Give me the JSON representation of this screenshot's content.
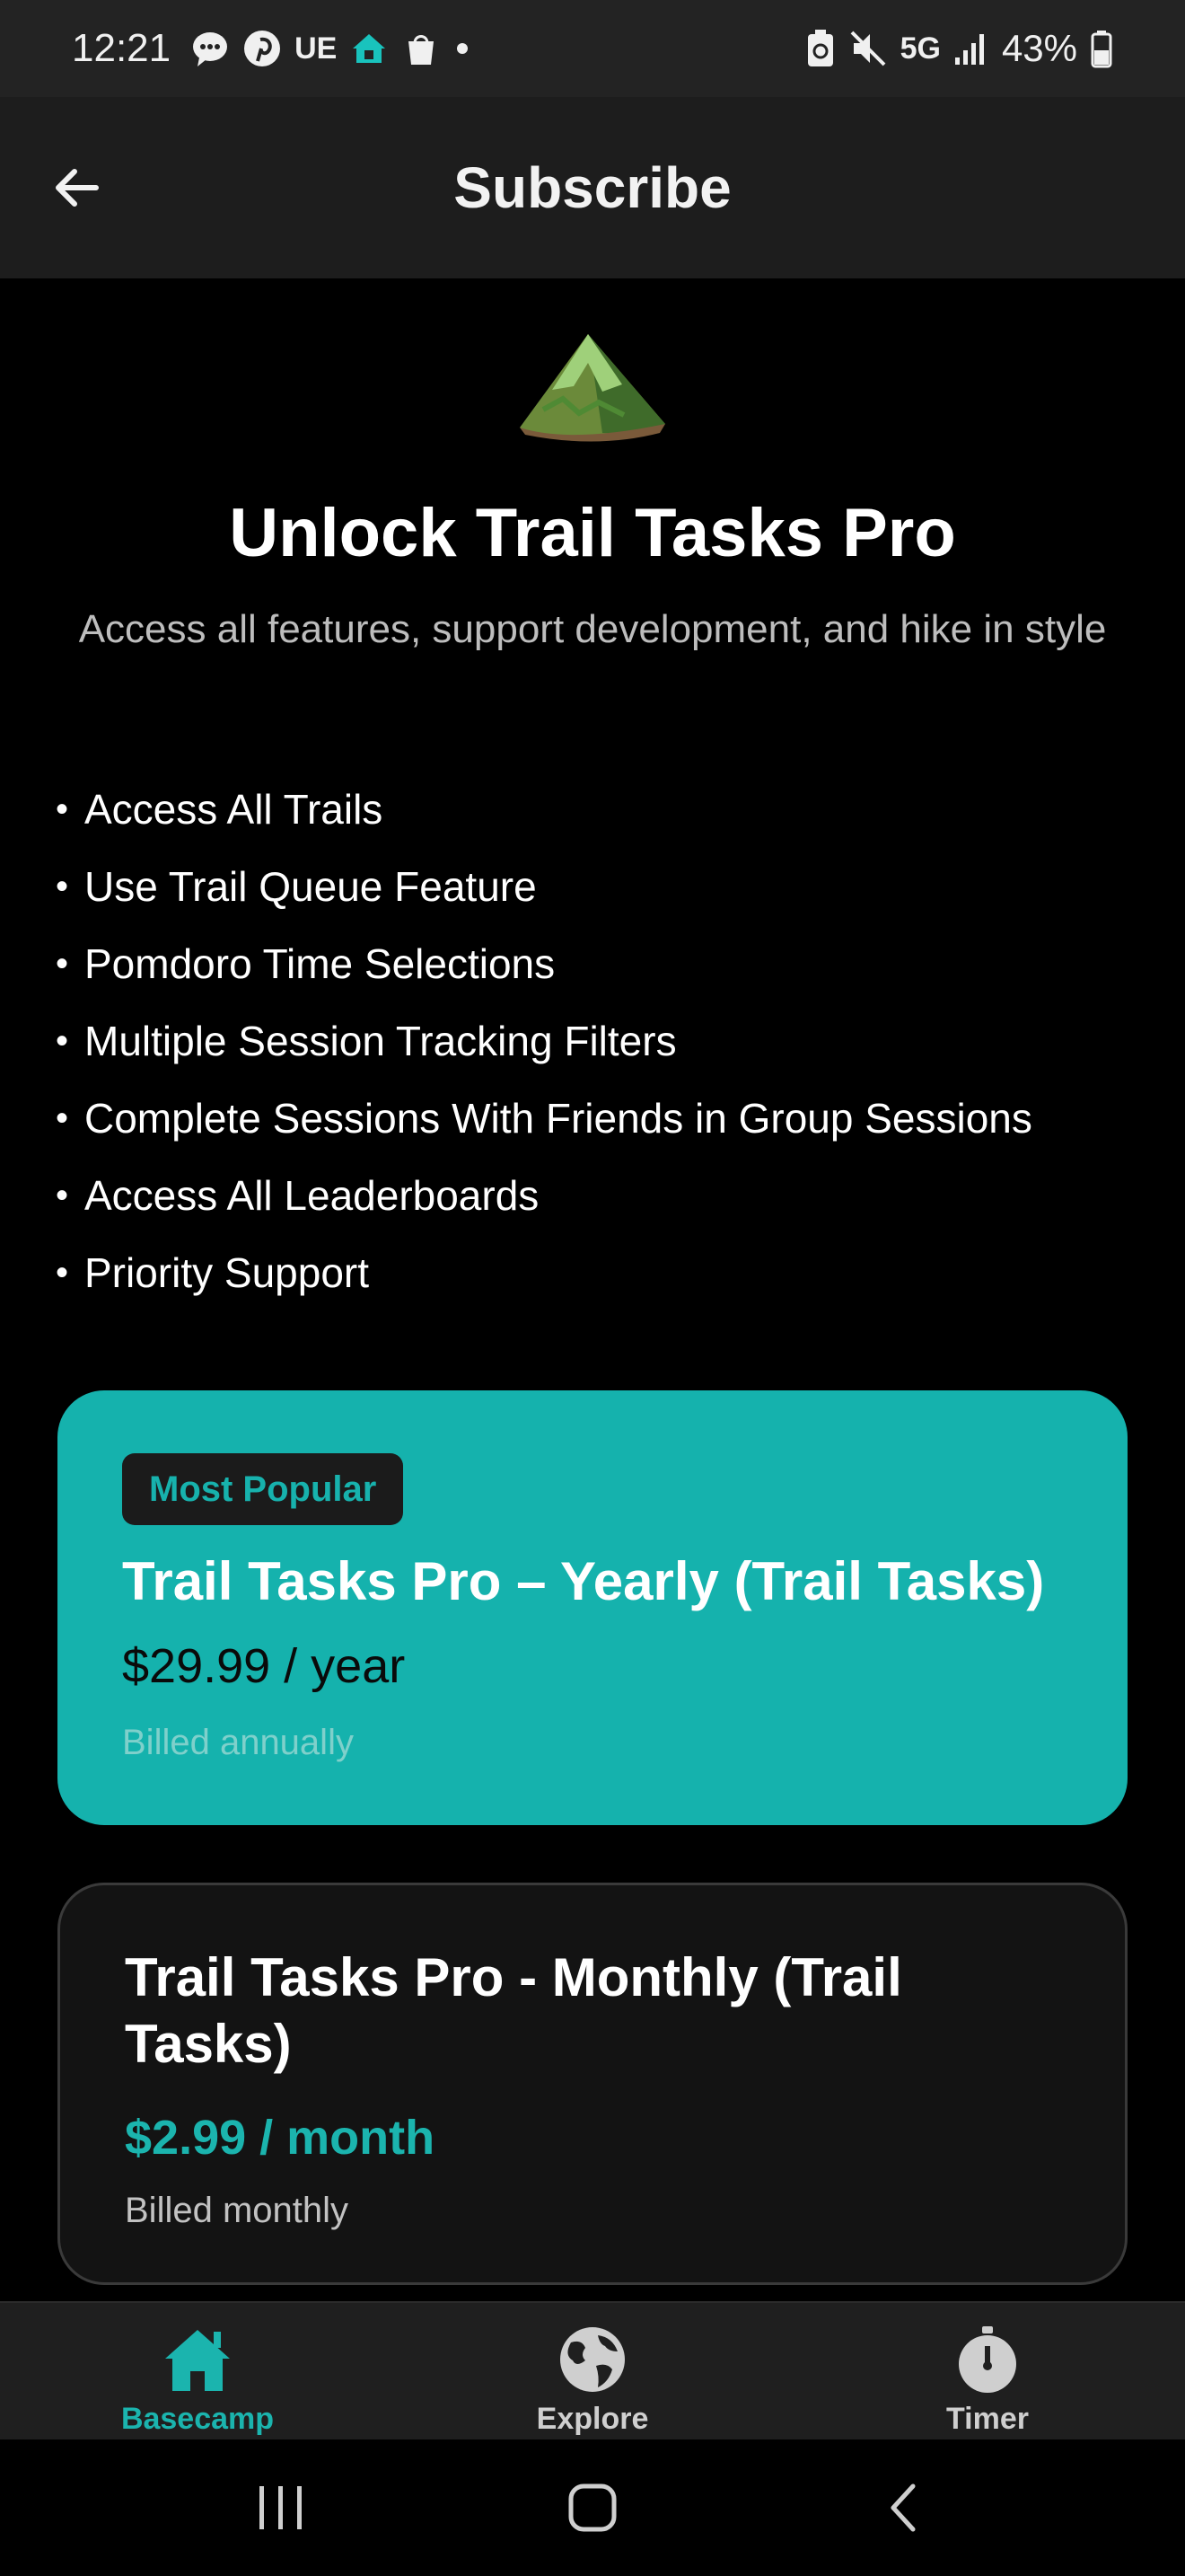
{
  "status_bar": {
    "time": "12:21",
    "carrier_text": "UE",
    "network": "5G",
    "battery": "43%"
  },
  "header": {
    "title": "Subscribe"
  },
  "hero": {
    "title": "Unlock Trail Tasks Pro",
    "subtitle": "Access all features, support development, and hike in style"
  },
  "features": [
    "Access All Trails",
    "Use Trail Queue Feature",
    "Pomdoro Time Selections",
    "Multiple Session Tracking Filters",
    "Complete Sessions With Friends in Group Sessions",
    "Access All Leaderboards",
    "Priority Support"
  ],
  "bullet": "•",
  "plans": [
    {
      "badge": "Most Popular",
      "name": "Trail Tasks Pro – Yearly (Trail Tasks)",
      "price": "$29.99 / year",
      "billing": "Billed annually"
    },
    {
      "name": "Trail Tasks Pro - Monthly (Trail Tasks)",
      "price": "$2.99 / month",
      "billing": "Billed monthly"
    }
  ],
  "bottom_nav": [
    {
      "label": "Basecamp",
      "icon": "house-icon",
      "active": true
    },
    {
      "label": "Explore",
      "icon": "globe-icon",
      "active": false
    },
    {
      "label": "Timer",
      "icon": "stopwatch-icon",
      "active": false
    }
  ],
  "colors": {
    "accent": "#15b2ad",
    "background": "#000000",
    "header": "#1d1d1d"
  }
}
